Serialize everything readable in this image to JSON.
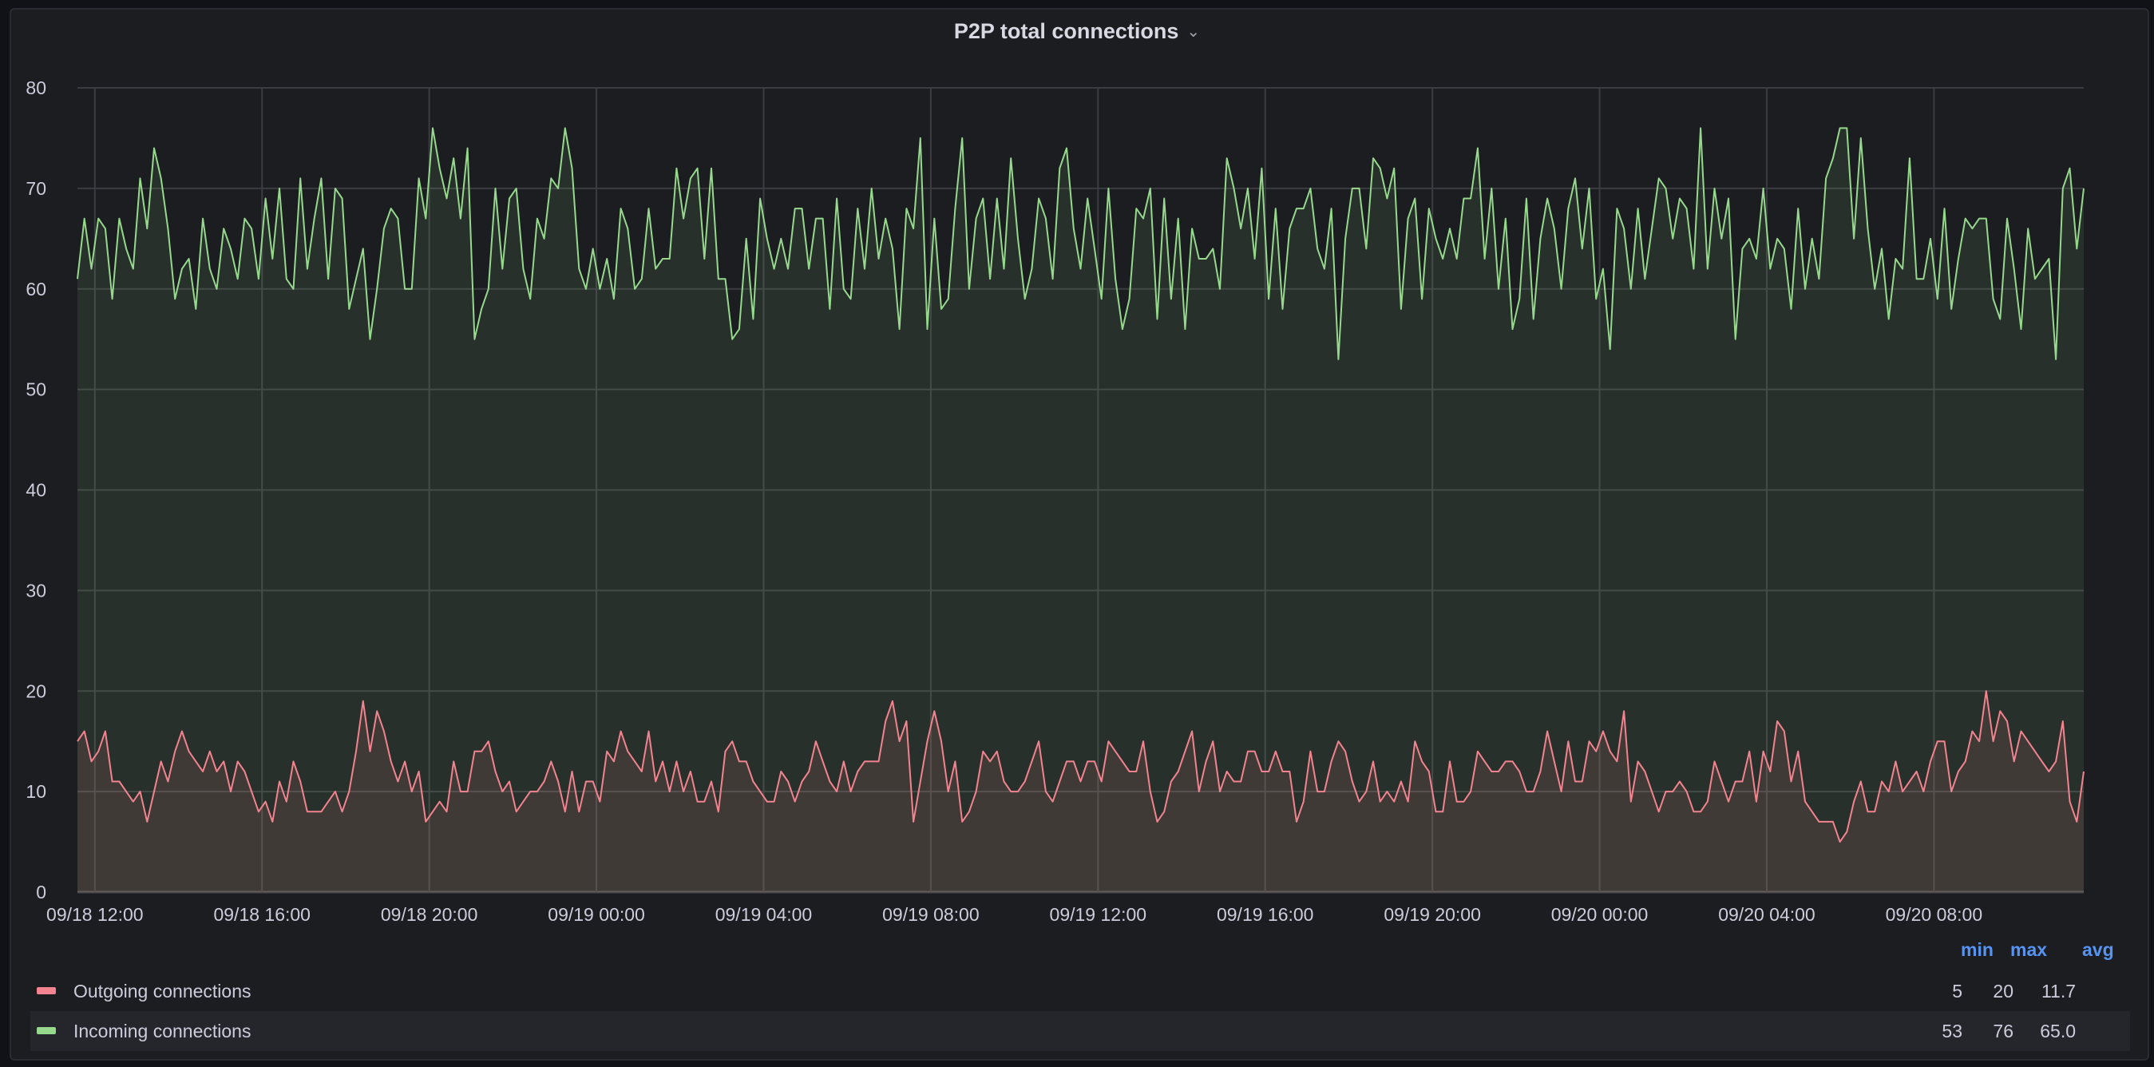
{
  "panel": {
    "title": "P2P total connections",
    "menu_icon": "chevron-down-icon"
  },
  "legend": {
    "headers": {
      "min": "min",
      "max": "max",
      "avg": "avg"
    },
    "items": [
      {
        "label": "Outgoing connections",
        "color": "#f2838f",
        "min": "5",
        "max": "20",
        "avg": "11.7"
      },
      {
        "label": "Incoming connections",
        "color": "#96d98d",
        "min": "53",
        "max": "76",
        "avg": "65.0"
      }
    ]
  },
  "chart_data": {
    "type": "area",
    "title": "P2P total connections",
    "xlabel": "",
    "ylabel": "",
    "ylim": [
      0,
      80
    ],
    "yticks": [
      0,
      10,
      20,
      30,
      40,
      50,
      60,
      70,
      80
    ],
    "grid": true,
    "legend_position": "bottom",
    "x_interval_minutes": 10,
    "x_start": "09/18 11:35",
    "x_end": "09/20 11:35",
    "xticks": [
      {
        "label": "09/18 12:00",
        "hours_from_start": 0.4167
      },
      {
        "label": "09/18 16:00",
        "hours_from_start": 4.4167
      },
      {
        "label": "09/18 20:00",
        "hours_from_start": 8.4167
      },
      {
        "label": "09/19 00:00",
        "hours_from_start": 12.4167
      },
      {
        "label": "09/19 04:00",
        "hours_from_start": 16.4167
      },
      {
        "label": "09/19 08:00",
        "hours_from_start": 20.4167
      },
      {
        "label": "09/19 12:00",
        "hours_from_start": 24.4167
      },
      {
        "label": "09/19 16:00",
        "hours_from_start": 28.4167
      },
      {
        "label": "09/19 20:00",
        "hours_from_start": 32.4167
      },
      {
        "label": "09/20 00:00",
        "hours_from_start": 36.4167
      },
      {
        "label": "09/20 04:00",
        "hours_from_start": 40.4167
      },
      {
        "label": "09/20 08:00",
        "hours_from_start": 44.4167
      }
    ],
    "series": [
      {
        "name": "Outgoing connections",
        "color": "#f2838f",
        "values": [
          15,
          16,
          13,
          14,
          16,
          11,
          11,
          10,
          9,
          10,
          7,
          10,
          13,
          11,
          14,
          16,
          14,
          13,
          12,
          14,
          12,
          13,
          10,
          13,
          12,
          10,
          8,
          9,
          7,
          11,
          9,
          13,
          11,
          8,
          8,
          8,
          9,
          10,
          8,
          10,
          14,
          19,
          14,
          18,
          16,
          13,
          11,
          13,
          10,
          12,
          7,
          8,
          9,
          8,
          13,
          10,
          10,
          14,
          14,
          15,
          12,
          10,
          11,
          8,
          9,
          10,
          10,
          11,
          13,
          11,
          8,
          12,
          8,
          11,
          11,
          9,
          14,
          13,
          16,
          14,
          13,
          12,
          16,
          11,
          13,
          10,
          13,
          10,
          12,
          9,
          9,
          11,
          8,
          14,
          15,
          13,
          13,
          11,
          10,
          9,
          9,
          12,
          11,
          9,
          11,
          12,
          15,
          13,
          11,
          10,
          13,
          10,
          12,
          13,
          13,
          13,
          17,
          19,
          15,
          17,
          7,
          11,
          15,
          18,
          15,
          10,
          13,
          7,
          8,
          10,
          14,
          13,
          14,
          11,
          10,
          10,
          11,
          13,
          15,
          10,
          9,
          11,
          13,
          13,
          11,
          13,
          13,
          11,
          15,
          14,
          13,
          12,
          12,
          15,
          10,
          7,
          8,
          11,
          12,
          14,
          16,
          10,
          13,
          15,
          10,
          12,
          11,
          11,
          14,
          14,
          12,
          12,
          14,
          12,
          12,
          7,
          9,
          14,
          10,
          10,
          13,
          15,
          14,
          11,
          9,
          10,
          13,
          9,
          10,
          9,
          11,
          9,
          15,
          13,
          12,
          8,
          8,
          13,
          9,
          9,
          10,
          14,
          13,
          12,
          12,
          13,
          13,
          12,
          10,
          10,
          12,
          16,
          13,
          10,
          15,
          11,
          11,
          15,
          14,
          16,
          14,
          13,
          18,
          9,
          13,
          12,
          10,
          8,
          10,
          10,
          11,
          10,
          8,
          8,
          9,
          13,
          11,
          9,
          11,
          11,
          14,
          9,
          14,
          12,
          17,
          16,
          11,
          14,
          9,
          8,
          7,
          7,
          7,
          5,
          6,
          9,
          11,
          8,
          8,
          11,
          10,
          13,
          10,
          11,
          12,
          10,
          13,
          15,
          15,
          10,
          12,
          13,
          16,
          15,
          20,
          15,
          18,
          17,
          13,
          16,
          15,
          14,
          13,
          12,
          13,
          17,
          9,
          7,
          12
        ]
      },
      {
        "name": "Incoming connections",
        "color": "#96d98d",
        "values": [
          61,
          67,
          62,
          67,
          66,
          59,
          67,
          64,
          62,
          71,
          66,
          74,
          71,
          66,
          59,
          62,
          63,
          58,
          67,
          62,
          60,
          66,
          64,
          61,
          67,
          66,
          61,
          69,
          63,
          70,
          61,
          60,
          71,
          62,
          67,
          71,
          61,
          70,
          69,
          58,
          61,
          64,
          55,
          60,
          66,
          68,
          67,
          60,
          60,
          71,
          67,
          76,
          72,
          69,
          73,
          67,
          74,
          55,
          58,
          60,
          70,
          62,
          69,
          70,
          62,
          59,
          67,
          65,
          71,
          70,
          76,
          72,
          62,
          60,
          64,
          60,
          63,
          59,
          68,
          66,
          60,
          61,
          68,
          62,
          63,
          63,
          72,
          67,
          71,
          72,
          63,
          72,
          61,
          61,
          55,
          56,
          65,
          57,
          69,
          65,
          62,
          65,
          62,
          68,
          68,
          62,
          67,
          67,
          58,
          69,
          60,
          59,
          68,
          62,
          70,
          63,
          67,
          64,
          56,
          68,
          66,
          75,
          56,
          67,
          58,
          59,
          68,
          75,
          60,
          67,
          69,
          61,
          69,
          62,
          73,
          65,
          59,
          62,
          69,
          67,
          61,
          72,
          74,
          66,
          62,
          69,
          64,
          59,
          70,
          61,
          56,
          59,
          68,
          67,
          70,
          57,
          69,
          59,
          67,
          56,
          66,
          63,
          63,
          64,
          60,
          73,
          70,
          66,
          70,
          63,
          72,
          59,
          68,
          58,
          66,
          68,
          68,
          70,
          64,
          62,
          68,
          53,
          65,
          70,
          70,
          64,
          73,
          72,
          69,
          72,
          58,
          67,
          69,
          59,
          68,
          65,
          63,
          66,
          63,
          69,
          69,
          74,
          63,
          70,
          60,
          67,
          56,
          59,
          69,
          57,
          65,
          69,
          66,
          60,
          68,
          71,
          64,
          70,
          59,
          62,
          54,
          68,
          66,
          60,
          68,
          61,
          66,
          71,
          70,
          65,
          69,
          68,
          62,
          76,
          62,
          70,
          65,
          69,
          55,
          64,
          65,
          63,
          70,
          62,
          65,
          64,
          58,
          68,
          60,
          65,
          61,
          71,
          73,
          76,
          76,
          65,
          75,
          66,
          60,
          64,
          57,
          63,
          62,
          73,
          61,
          61,
          65,
          59,
          68,
          58,
          63,
          67,
          66,
          67,
          67,
          59,
          57,
          67,
          62,
          56,
          66,
          61,
          62,
          63,
          53,
          70,
          72,
          64,
          70
        ]
      }
    ]
  }
}
